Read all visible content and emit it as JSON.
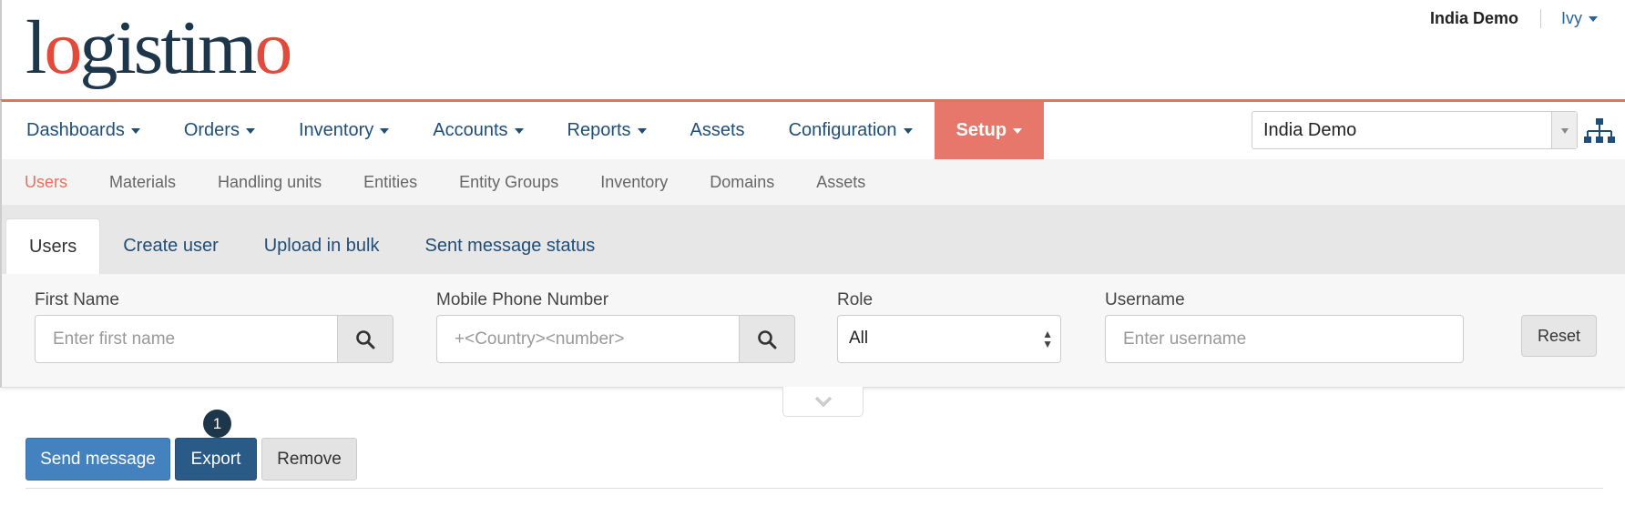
{
  "app": {
    "logo_text": "logistimo"
  },
  "header": {
    "domain_name": "India Demo",
    "user_name": "Ivy"
  },
  "main_nav": {
    "items": [
      {
        "label": "Dashboards",
        "has_dropdown": true
      },
      {
        "label": "Orders",
        "has_dropdown": true
      },
      {
        "label": "Inventory",
        "has_dropdown": true
      },
      {
        "label": "Accounts",
        "has_dropdown": true
      },
      {
        "label": "Reports",
        "has_dropdown": true
      },
      {
        "label": "Assets",
        "has_dropdown": false
      },
      {
        "label": "Configuration",
        "has_dropdown": true
      },
      {
        "label": "Setup",
        "has_dropdown": true,
        "active": true
      }
    ],
    "domain_select_value": "India Demo",
    "active_color": "#e8776b"
  },
  "sub_nav": {
    "items": [
      "Users",
      "Materials",
      "Handling units",
      "Entities",
      "Entity Groups",
      "Inventory",
      "Domains",
      "Assets"
    ],
    "active": "Users"
  },
  "tabs": {
    "items": [
      "Users",
      "Create user",
      "Upload in bulk",
      "Sent message status"
    ],
    "active": "Users"
  },
  "filters": {
    "first_name": {
      "label": "First Name",
      "placeholder": "Enter first name"
    },
    "mobile": {
      "label": "Mobile Phone Number",
      "placeholder": "+<Country><number>"
    },
    "role": {
      "label": "Role",
      "value": "All"
    },
    "username": {
      "label": "Username",
      "placeholder": "Enter username"
    },
    "reset_label": "Reset"
  },
  "actions": {
    "badge": "1",
    "send_message": "Send message",
    "export": "Export",
    "remove": "Remove"
  },
  "colors": {
    "brand_dark": "#1d3649",
    "brand_accent": "#e24b3b",
    "primary_blue": "#4482bf"
  }
}
